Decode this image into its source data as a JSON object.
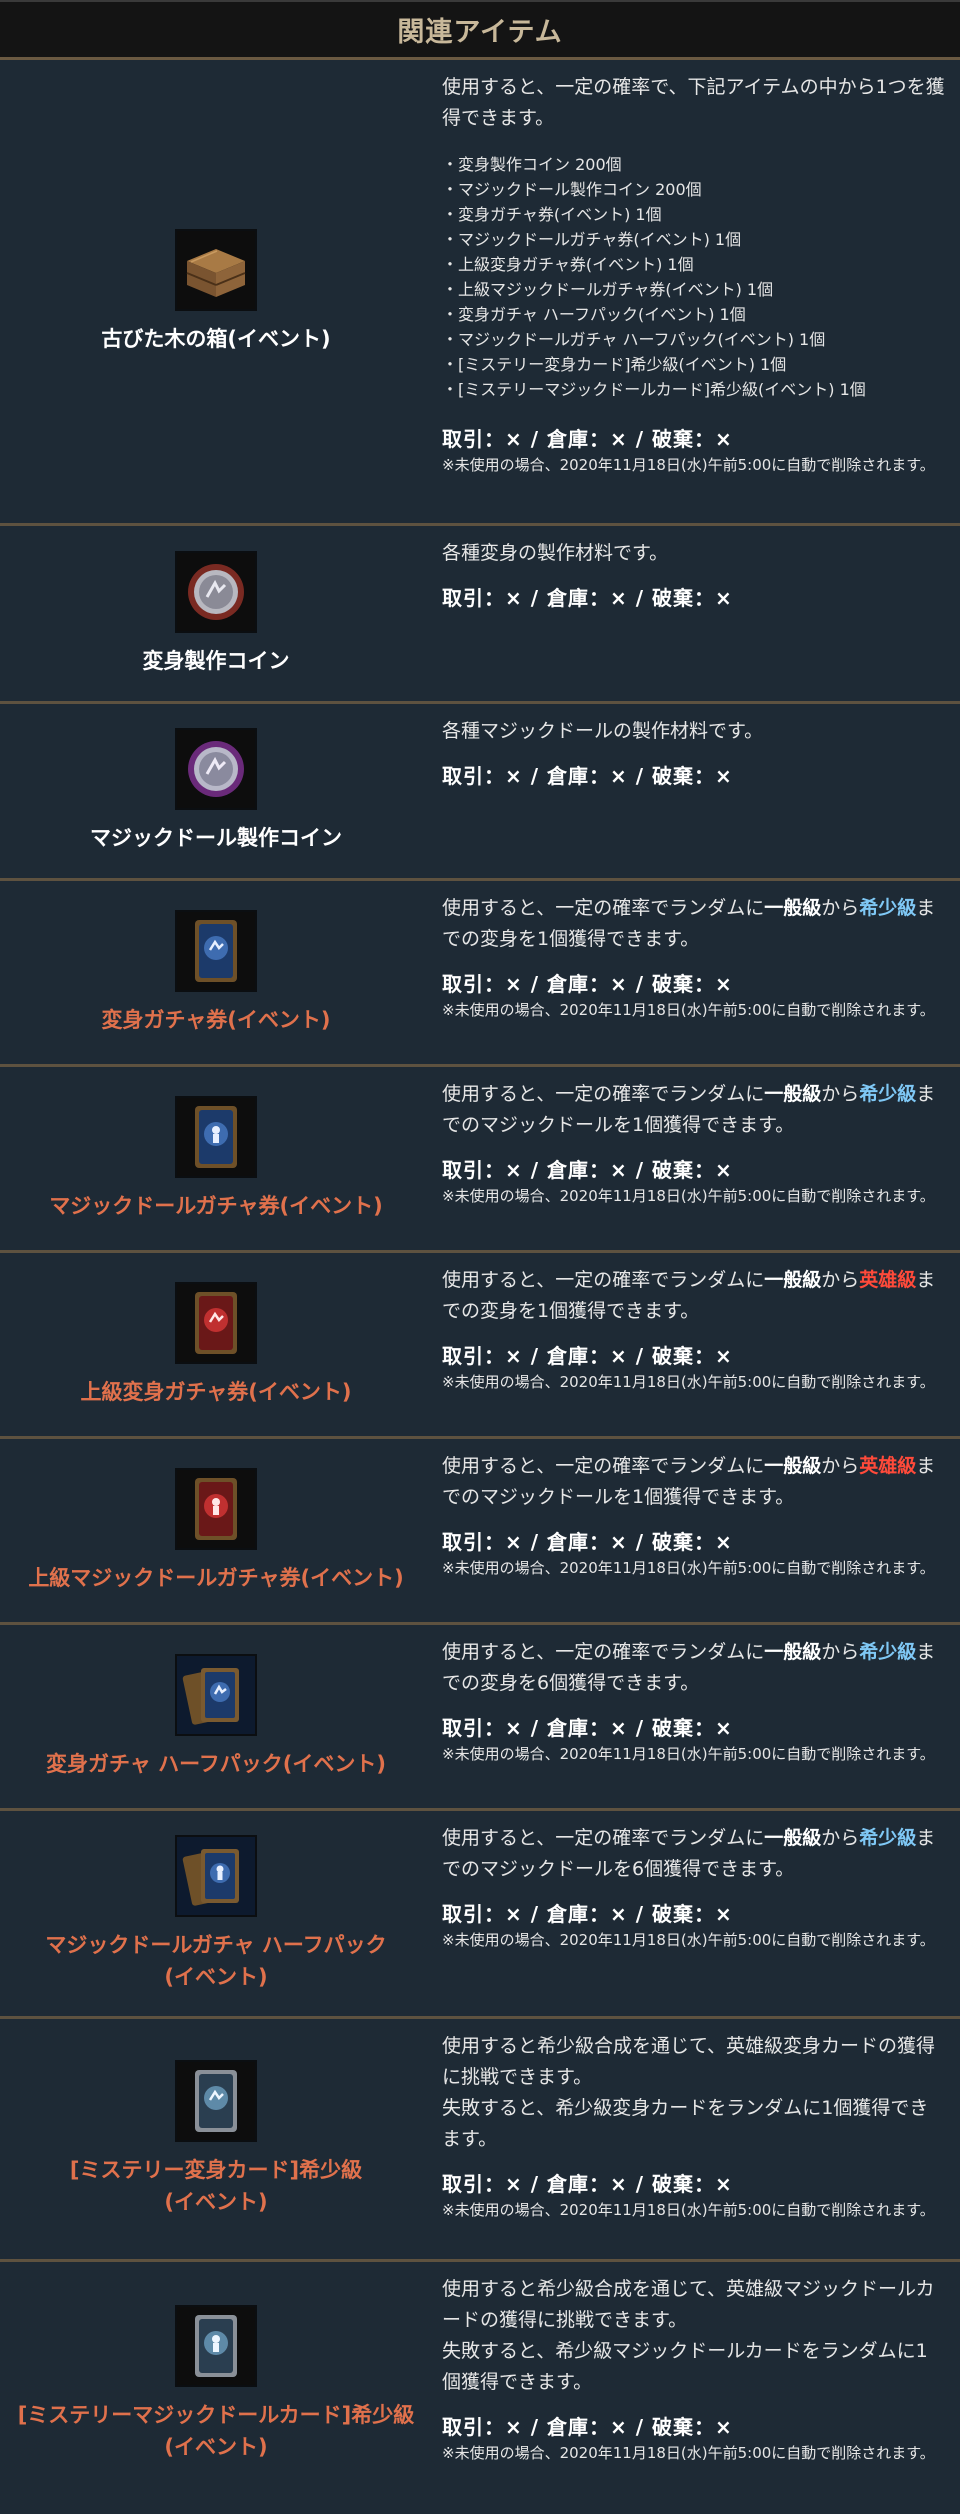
{
  "header": {
    "title": "関連アイテム"
  },
  "stats_label": "取引：× / 倉庫：× / 破棄：×",
  "note_text": "※未使用の場合、2020年11月18日(水)午前5:00に自動で削除されます。",
  "items": [
    {
      "name": "古びた木の箱(イベント)",
      "icon": "wooden-box-icon",
      "desc": "使用すると、一定の確率で、下記アイテムの中から1つを獲得できます。",
      "list": [
        "・変身製作コイン 200個",
        "・マジックドール製作コイン 200個",
        "・変身ガチャ券(イベント) 1個",
        "・マジックドールガチャ券(イベント) 1個",
        "・上級変身ガチャ券(イベント) 1個",
        "・上級マジックドールガチャ券(イベント) 1個",
        "・変身ガチャ ハーフパック(イベント) 1個",
        "・マジックドールガチャ ハーフパック(イベント) 1個",
        "・[ミステリー変身カード]希少級(イベント) 1個",
        "・[ミステリーマジックドールカード]希少級(イベント) 1個"
      ]
    },
    {
      "name": "変身製作コイン",
      "icon": "polymorph-coin-icon",
      "desc": "各種変身の製作材料です。"
    },
    {
      "name": "マジックドール製作コイン",
      "icon": "magic-doll-coin-icon",
      "desc": "各種マジックドールの製作材料です。"
    },
    {
      "name": "変身ガチャ券(イベント)",
      "icon": "polymorph-ticket-icon",
      "desc_a": "使用すると、一定の確率でランダムに",
      "w1": "一般級",
      "mid": "から",
      "w2": "希少級",
      "desc_b": "までの変身を1個獲得できます。"
    },
    {
      "name": "マジックドールガチャ券(イベント)",
      "icon": "magic-doll-ticket-icon",
      "desc_a": "使用すると、一定の確率でランダムに",
      "w1": "一般級",
      "mid": "から",
      "w2": "希少級",
      "desc_b": "までのマジックドールを1個獲得できます。"
    },
    {
      "name": "上級変身ガチャ券(イベント)",
      "icon": "advanced-polymorph-ticket-icon",
      "desc_a": "使用すると、一定の確率でランダムに",
      "w1": "一般級",
      "mid": "から",
      "w2": "英雄級",
      "desc_b": "までの変身を1個獲得できます。"
    },
    {
      "name": "上級マジックドールガチャ券(イベント)",
      "icon": "advanced-magic-doll-ticket-icon",
      "desc_a": "使用すると、一定の確率でランダムに",
      "w1": "一般級",
      "mid": "から",
      "w2": "英雄級",
      "desc_b": "までのマジックドールを1個獲得できます。"
    },
    {
      "name": "変身ガチャ ハーフパック(イベント)",
      "icon": "polymorph-halfpack-icon",
      "desc_a": "使用すると、一定の確率でランダムに",
      "w1": "一般級",
      "mid": "から",
      "w2": "希少級",
      "desc_b": "までの変身を6個獲得できます。"
    },
    {
      "name_1": "マジックドールガチャ ハーフパック",
      "name_2": "(イベント)",
      "icon": "magic-doll-halfpack-icon",
      "desc_a": "使用すると、一定の確率でランダムに",
      "w1": "一般級",
      "mid": "から",
      "w2": "希少級",
      "desc_b": "までのマジックドールを6個獲得できます。"
    },
    {
      "name_1": "[ミステリー変身カード]希少級",
      "name_2": "(イベント)",
      "icon": "mystery-polymorph-card-icon",
      "desc_1": "使用すると希少級合成を通じて、英雄級変身カードの獲得に挑戦できます。",
      "desc_2": "失敗すると、希少級変身カードをランダムに1個獲得できます。"
    },
    {
      "name_1": "[ミステリーマジックドールカード]希少級",
      "name_2": "(イベント)",
      "icon": "mystery-magic-doll-card-icon",
      "desc_1": "使用すると希少級合成を通じて、英雄級マジックドールカードの獲得に挑戦できます。",
      "desc_2": "失敗すると、希少級マジックドールカードをランダムに1個獲得できます。"
    }
  ]
}
